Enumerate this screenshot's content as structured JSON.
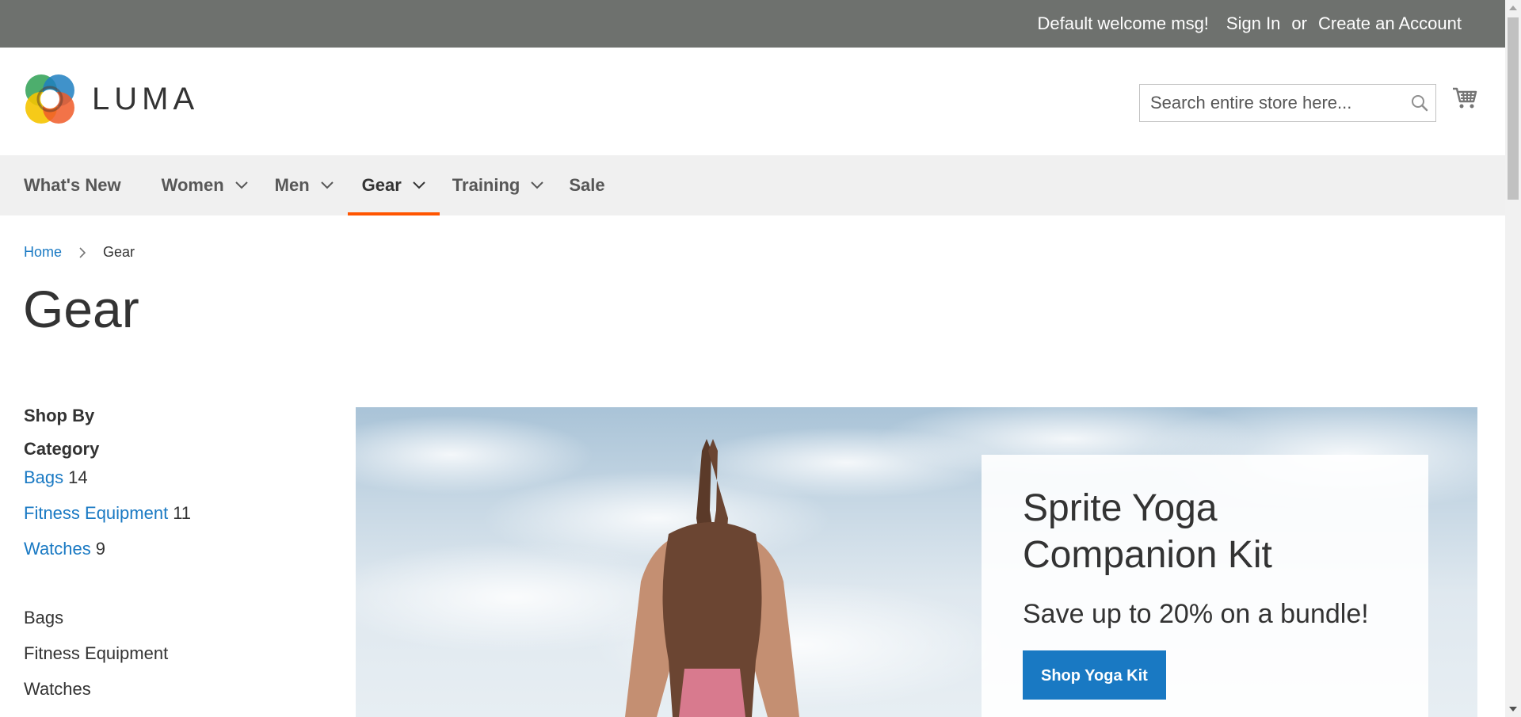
{
  "top_panel": {
    "welcome": "Default welcome msg!",
    "sign_in": "Sign In",
    "or": "or",
    "create_account": "Create an Account"
  },
  "header": {
    "logo_text": "LUMA",
    "search_placeholder": "Search entire store here...",
    "search_icon": "search-icon",
    "cart_icon": "cart-icon"
  },
  "nav": {
    "items": [
      {
        "label": "What's New",
        "has_dropdown": false
      },
      {
        "label": "Women",
        "has_dropdown": true
      },
      {
        "label": "Men",
        "has_dropdown": true
      },
      {
        "label": "Gear",
        "has_dropdown": true,
        "active": true
      },
      {
        "label": "Training",
        "has_dropdown": true
      },
      {
        "label": "Sale",
        "has_dropdown": false
      }
    ],
    "active_color": "#ff5501"
  },
  "breadcrumbs": {
    "home": "Home",
    "current": "Gear"
  },
  "page_title": "Gear",
  "sidebar": {
    "shop_by": "Shop By",
    "category_title": "Category",
    "categories": [
      {
        "label": "Bags",
        "count": "14"
      },
      {
        "label": "Fitness Equipment",
        "count": "11"
      },
      {
        "label": "Watches",
        "count": "9"
      }
    ],
    "subcategories": [
      "Bags",
      "Fitness Equipment",
      "Watches"
    ]
  },
  "hero": {
    "title": "Sprite Yoga Companion Kit",
    "subtitle": "Save up to 20% on a bundle!",
    "button": "Shop Yoga Kit"
  },
  "colors": {
    "link": "#1979c3",
    "top_panel_bg": "#6e716e",
    "nav_bg": "#f0f0f0",
    "button_bg": "#1979c3"
  }
}
